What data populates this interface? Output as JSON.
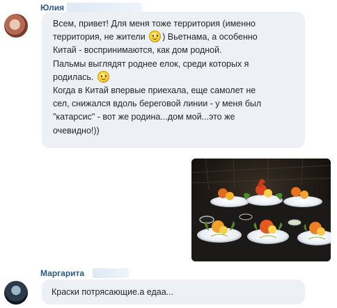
{
  "messages": [
    {
      "author": "Юлия",
      "lines": [
        "Всем, привет! Для меня тоже территория (именно",
        "территория, не жители",
        ")  Вьетнама, а особенно",
        "Китай - воспринимаются, как дом родной.",
        "Пальмы выглядят роднее елок, среди которых я",
        "родилась.",
        "Когда в Китай впервые приехала, еще самолет не",
        "сел, снижался вдоль береговой линии - у меня был",
        "\"катарсис\" - вот же родина...дом мой...это же",
        "очевидно!))"
      ],
      "emoji_icon": "smile-emoji-icon"
    },
    {
      "author": "Маргарита",
      "text": "Краски потрясающие.а едаа..."
    }
  ],
  "attachment": {
    "type": "photo",
    "subject": "plates with carved vegetable flower decorations on a buffet table"
  }
}
